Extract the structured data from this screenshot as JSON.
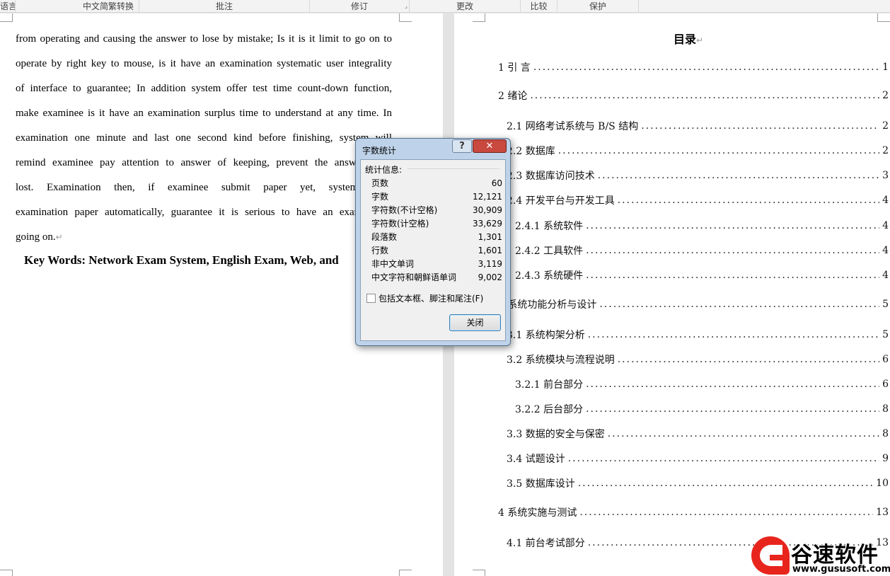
{
  "ribbon": {
    "groups": [
      "语言",
      "中文简繁转换",
      "批注",
      "修订",
      "更改",
      "比较",
      "保护"
    ]
  },
  "document": {
    "left_page": {
      "lines": [
        "from operating and causing the answer to lose by mistake; Is it is it limit to go on to",
        "operate by right key to mouse, is it have an examination systematic user integrality",
        "of interface to guarantee; In addition system offer test time count-down function,",
        "make examinee is it have an examination surplus time to understand at any time. In",
        "examination one minute and last one second kind before finishing, system will",
        "remind examinee pay attention to answer of keeping, prevent the answer from",
        "lost. Examination then, if examinee submit paper yet, system hand",
        "examination paper automatically, guarantee it is serious to have an examination",
        "going on."
      ],
      "paragraph_mark": "↵",
      "keywords": "Key Words: Network Exam System, English Exam, Web, and"
    },
    "toc": {
      "title": "目录",
      "entries": [
        {
          "label": "1 引  言",
          "page": "1"
        },
        {
          "label": "2 绪论",
          "page": "2"
        },
        {
          "label": "2.1 网络考试系统与 B/S 结构",
          "page": "2"
        },
        {
          "label": "2.2 数据库",
          "page": "2"
        },
        {
          "label": "2.3 数据库访问技术",
          "page": "3"
        },
        {
          "label": "2.4 开发平台与开发工具",
          "page": "4"
        },
        {
          "label": "2.4.1 系统软件",
          "page": "4"
        },
        {
          "label": "2.4.2 工具软件",
          "page": "4"
        },
        {
          "label": "2.4.3 系统硬件",
          "page": "4"
        },
        {
          "label": "3 系统功能分析与设计",
          "page": "5"
        },
        {
          "label": "3.1 系统构架分析",
          "page": "5"
        },
        {
          "label": "3.2 系统模块与流程说明",
          "page": "6"
        },
        {
          "label": "3.2.1 前台部分",
          "page": "6"
        },
        {
          "label": "3.2.2 后台部分",
          "page": "8"
        },
        {
          "label": "3.3 数据的安全与保密",
          "page": "8"
        },
        {
          "label": "3.4 试题设计",
          "page": "9"
        },
        {
          "label": "3.5 数据库设计",
          "page": "10"
        },
        {
          "label": "4 系统实施与测试",
          "page": "13"
        },
        {
          "label": "4.1 前台考试部分",
          "page": "13"
        }
      ]
    }
  },
  "dialog": {
    "title": "字数统计",
    "help_label": "?",
    "close_x": "✕",
    "section_label": "统计信息:",
    "stats": [
      {
        "label": "页数",
        "value": "60"
      },
      {
        "label": "字数",
        "value": "12,121"
      },
      {
        "label": "字符数(不计空格)",
        "value": "30,909"
      },
      {
        "label": "字符数(计空格)",
        "value": "33,629"
      },
      {
        "label": "段落数",
        "value": "1,301"
      },
      {
        "label": "行数",
        "value": "1,601"
      },
      {
        "label": "非中文单词",
        "value": "3,119"
      },
      {
        "label": "中文字符和朝鲜语单词",
        "value": "9,002"
      }
    ],
    "checkbox_label": "包括文本框、脚注和尾注(F)",
    "checkbox_checked": false,
    "close_button": "关闭"
  },
  "watermark": {
    "brand": "谷速软件",
    "url": "www.gususoft.com",
    "color": "#e8251d"
  }
}
